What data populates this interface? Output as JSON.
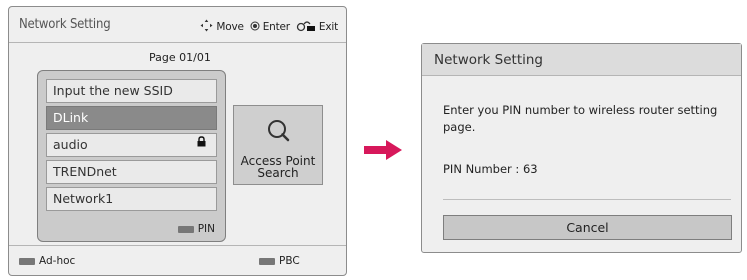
{
  "left_dialog": {
    "title": "Network Setting",
    "hints": {
      "move": "Move",
      "enter": "Enter",
      "exit": "Exit"
    },
    "page_indicator": "Page 01/01",
    "networks": [
      {
        "label": "Input the new SSID",
        "selected": false,
        "locked": false
      },
      {
        "label": "DLink",
        "selected": true,
        "locked": false
      },
      {
        "label": "audio",
        "selected": false,
        "locked": true
      },
      {
        "label": "TRENDnet",
        "selected": false,
        "locked": false
      },
      {
        "label": "Network1",
        "selected": false,
        "locked": false
      }
    ],
    "pin_legend": "PIN",
    "ap_search": {
      "line1": "Access Point",
      "line2": "Search"
    },
    "footer": {
      "adhoc": "Ad-hoc",
      "pbc": "PBC"
    }
  },
  "right_dialog": {
    "title": "Network Setting",
    "message": "Enter you PIN number to wireless router setting page.",
    "pin_label": "PIN Number : 63",
    "cancel_label": "Cancel"
  },
  "colors": {
    "arrow": "#d7185b",
    "selected_item": "#8a8a8a",
    "panel_bg": "#efefef"
  },
  "icons": [
    "move-arrows-icon",
    "enter-circle-icon",
    "exit-icon",
    "lock-icon",
    "search-magnifier-icon",
    "right-arrow-icon"
  ]
}
